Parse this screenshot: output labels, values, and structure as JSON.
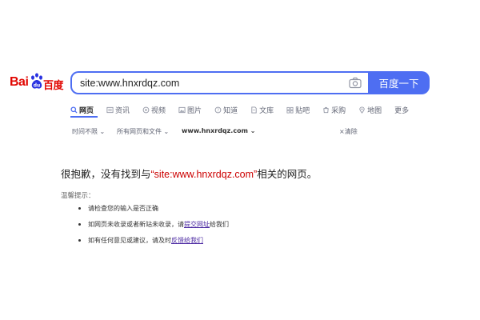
{
  "logo": {
    "bai": "Bai",
    "du": "百度"
  },
  "search": {
    "query": "site:www.hnxrdqz.com",
    "button_label": "百度一下"
  },
  "tabs": [
    {
      "label": "网页",
      "icon": "search-icon",
      "active": true
    },
    {
      "label": "资讯",
      "icon": "news-icon"
    },
    {
      "label": "视频",
      "icon": "video-icon"
    },
    {
      "label": "图片",
      "icon": "image-icon"
    },
    {
      "label": "知道",
      "icon": "question-icon"
    },
    {
      "label": "文库",
      "icon": "document-icon"
    },
    {
      "label": "贴吧",
      "icon": "forum-icon"
    },
    {
      "label": "采购",
      "icon": "shopping-icon"
    },
    {
      "label": "地图",
      "icon": "map-icon"
    },
    {
      "label": "更多"
    }
  ],
  "filters": {
    "time": "时间不限",
    "type": "所有网页和文件",
    "site": "www.hnxrdqz.com",
    "clear": "清除"
  },
  "message": {
    "prefix": "很抱歉，没有找到与",
    "query": "“site:www.hnxrdqz.com”",
    "suffix": "相关的网页。"
  },
  "tips": {
    "title": "温馨提示：",
    "items": {
      "check": "请检查您的输入是否正确",
      "submit_prefix": "如网页未收录或者新站未收录，请",
      "submit_link": "提交网址",
      "submit_suffix": "给我们",
      "feedback_prefix": "如有任何意见或建议，请及时",
      "feedback_link": "反馈给我们"
    }
  },
  "colors": {
    "brand_blue": "#4e6ef2",
    "brand_red": "#e10601",
    "query_red": "#cc0000"
  }
}
